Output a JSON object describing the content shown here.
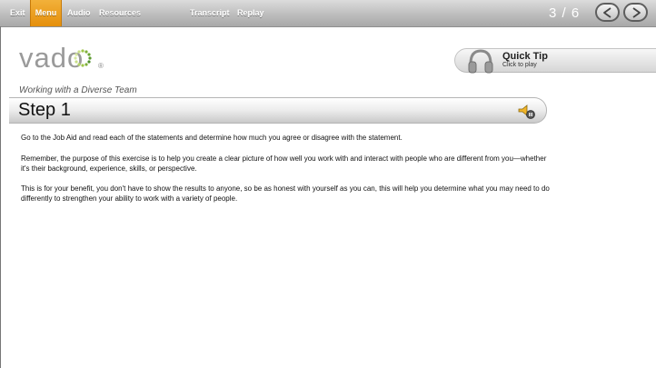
{
  "nav": {
    "exit": "Exit",
    "menu": "Menu",
    "audio": "Audio",
    "resources": "Resources",
    "transcript": "Transcript",
    "replay": "Replay"
  },
  "page_counter": "3 / 6",
  "logo": {
    "text": "vado",
    "mark": "®"
  },
  "quick_tip": {
    "title": "Quick Tip",
    "subtitle": "Click to play"
  },
  "course_title": "Working with a Diverse Team",
  "step_title": "Step 1",
  "paragraphs": [
    "Go to the Job Aid and read each of the statements and determine how much you agree or disagree with the statement.",
    "Remember, the purpose of this exercise is to help you create a clear picture of how well you work with and interact with people who are different from you—whether it's their background, experience, skills, or perspective.",
    "This is for your benefit, you don't have to show the results to anyone, so be as honest with yourself as you can, this will help you determine what you may need to do differently to strengthen your ability to work with a variety of people."
  ],
  "colors": {
    "accent": "#e8960f",
    "topbar": "#bdbdbd"
  }
}
